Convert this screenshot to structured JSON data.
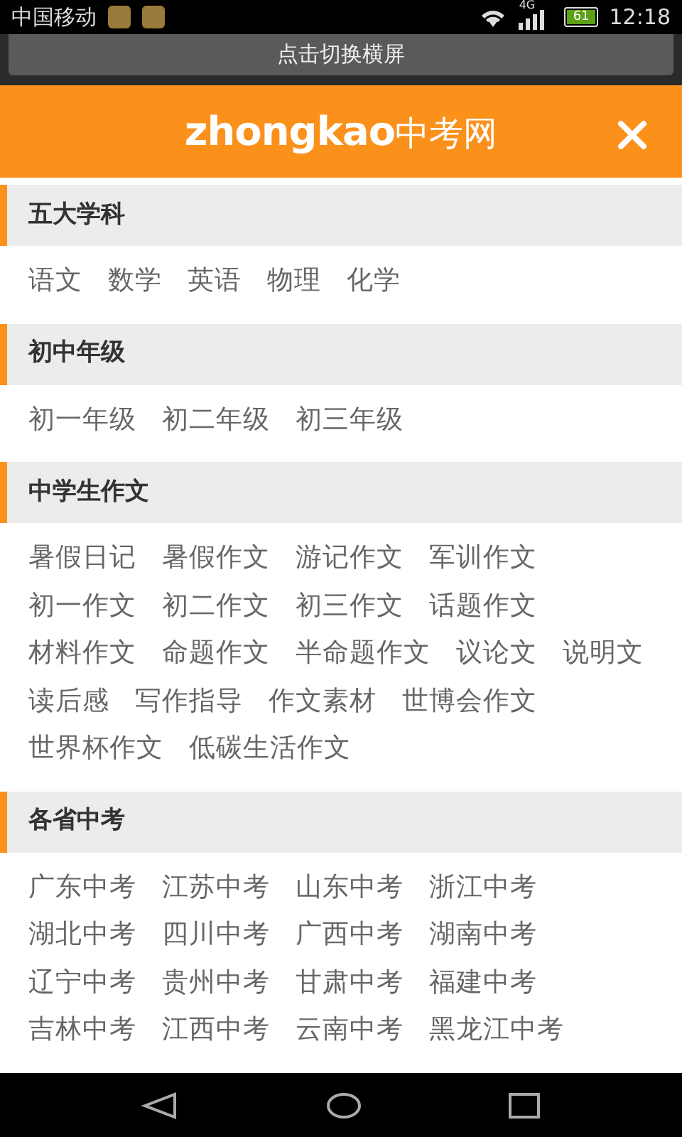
{
  "status_bar": {
    "carrier": "中国移动",
    "network": "4G",
    "battery": "61",
    "time": "12:18"
  },
  "rotate_button": {
    "label": "点击切换横屏"
  },
  "header": {
    "logo_latin": "zhongkao",
    "logo_cjk": "中考网"
  },
  "sections": [
    {
      "title": "五大学科",
      "links": [
        "语文",
        "数学",
        "英语",
        "物理",
        "化学"
      ]
    },
    {
      "title": "初中年级",
      "links": [
        "初一年级",
        "初二年级",
        "初三年级"
      ]
    },
    {
      "title": "中学生作文",
      "links": [
        "暑假日记",
        "暑假作文",
        "游记作文",
        "军训作文",
        "初一作文",
        "初二作文",
        "初三作文",
        "话题作文",
        "材料作文",
        "命题作文",
        "半命题作文",
        "议论文",
        "说明文",
        "读后感",
        "写作指导",
        "作文素材",
        "世博会作文",
        "世界杯作文",
        "低碳生活作文"
      ]
    },
    {
      "title": "各省中考",
      "links": [
        "广东中考",
        "江苏中考",
        "山东中考",
        "浙江中考",
        "湖北中考",
        "四川中考",
        "广西中考",
        "湖南中考",
        "辽宁中考",
        "贵州中考",
        "甘肃中考",
        "福建中考",
        "吉林中考",
        "江西中考",
        "云南中考",
        "黑龙江中考"
      ]
    }
  ]
}
